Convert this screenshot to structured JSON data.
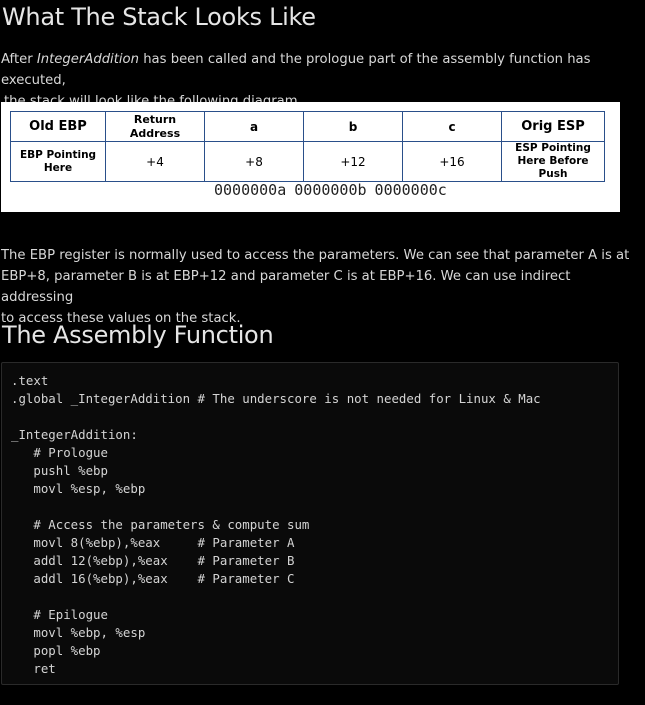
{
  "section1": {
    "title": "What The Stack Looks Like",
    "intro": {
      "line1_prefix": "After ",
      "function_name": "IntegerAddition",
      "line1_suffix": " has been called and the prologue part of the assembly function has executed,",
      "line2": "the stack will look like the following diagram."
    }
  },
  "diagram": {
    "headers": [
      "Old EBP",
      "Return Address",
      "a",
      "b",
      "c",
      "Orig ESP"
    ],
    "row2": [
      "EBP Pointing Here",
      "+4",
      "+8",
      "+12",
      "+16",
      "ESP Pointing Here Before Push"
    ],
    "param_values": "0000000a 0000000b 0000000c",
    "border_color": "#2a4f8a"
  },
  "section1_body": {
    "line1": "The EBP register is normally used to access the parameters. We can see that parameter A is at",
    "line2": "EBP+8, parameter B is at EBP+12 and parameter C is at EBP+16. We can use indirect addressing",
    "line3": "to access these values on the stack."
  },
  "section2": {
    "title": "The Assembly Function",
    "code": ".text\n.global _IntegerAddition # The underscore is not needed for Linux & Mac\n\n_IntegerAddition:\n   # Prologue\n   pushl %ebp\n   movl %esp, %ebp\n\n   # Access the parameters & compute sum\n   movl 8(%ebp),%eax     # Parameter A\n   addl 12(%ebp),%eax    # Parameter B\n   addl 16(%ebp),%eax    # Parameter C\n\n   # Epilogue\n   movl %ebp, %esp\n   popl %ebp\n   ret"
  }
}
